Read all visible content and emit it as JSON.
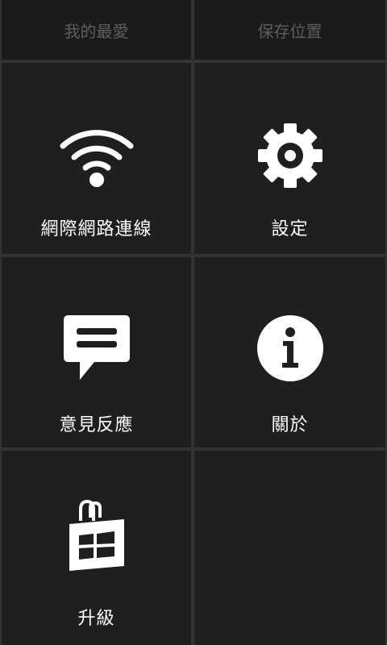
{
  "top_bar": {
    "favorites_label": "我的最愛",
    "save_location_label": "保存位置"
  },
  "tiles": [
    {
      "label": "網際網路連線",
      "icon": "wifi-icon"
    },
    {
      "label": "設定",
      "icon": "gear-icon"
    },
    {
      "label": "意見反應",
      "icon": "feedback-chat-icon"
    },
    {
      "label": "關於",
      "icon": "info-icon"
    },
    {
      "label": "升級",
      "icon": "store-bag-icon"
    }
  ],
  "colors": {
    "background": "#333333",
    "tile": "#1f1f1f",
    "top_button": "#1b1b1b",
    "top_text": "#5e5e5e",
    "text": "#ffffff"
  }
}
